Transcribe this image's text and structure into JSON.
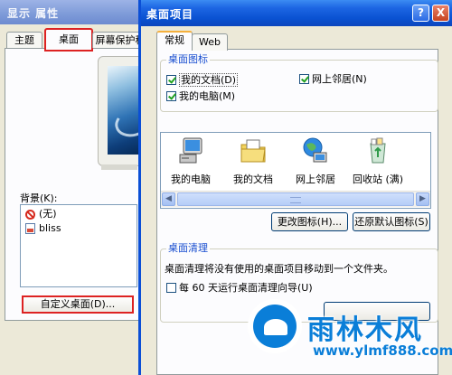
{
  "back_window": {
    "title": "显示 属性",
    "tabs": [
      "主题",
      "桌面",
      "屏幕保护程"
    ],
    "background_label": "背景(K):",
    "background_items": [
      "(无)",
      "bliss"
    ],
    "customize_button": "自定义桌面(D)..."
  },
  "dialog": {
    "title": "桌面项目",
    "help_button": "?",
    "close_button": "X",
    "tabs": [
      "常规",
      "Web"
    ],
    "desktop_icons": {
      "group_label": "桌面图标",
      "checkboxes": [
        {
          "text": "我的文档",
          "key": "D",
          "checked": true
        },
        {
          "text": "网上邻居",
          "key": "N",
          "checked": true
        },
        {
          "text": "我的电脑",
          "key": "M",
          "checked": true
        }
      ]
    },
    "icon_list": [
      "我的电脑",
      "我的文档",
      "网上邻居",
      "回收站 (满)",
      "回收"
    ],
    "change_icon_button": "更改图标(H)...",
    "restore_default_button": "还原默认图标(S)",
    "cleanup": {
      "group_label": "桌面清理",
      "description": "桌面清理将没有使用的桌面项目移动到一个文件夹。",
      "checkbox": "每 60 天运行桌面清理向导(U)",
      "checkbox_checked": false
    }
  },
  "watermark": {
    "text": "雨林木风",
    "url": "www.ylmf888.com"
  },
  "colors": {
    "accent_red": "#dd2222",
    "title_blue": "#0a52d2",
    "group_label_blue": "#1a4fd0",
    "watermark_blue": "#0a7ed8"
  }
}
